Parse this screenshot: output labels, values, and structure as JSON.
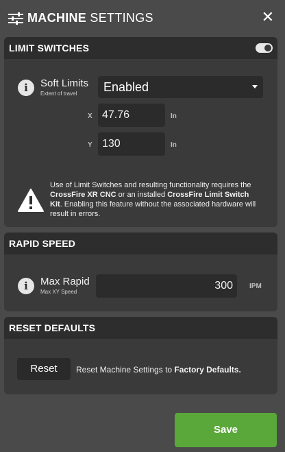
{
  "header": {
    "title_bold": "MACHINE",
    "title_rest": "SETTINGS",
    "close_label": "✕"
  },
  "limit_switches": {
    "title": "LIMIT SWITCHES",
    "toggle_on": true,
    "soft_limits_label": "Soft Limits",
    "soft_limits_sub": "Extent of travel",
    "soft_limits_value": "Enabled",
    "x_label": "X",
    "x_value": "47.76",
    "x_unit": "In",
    "y_label": "Y",
    "y_value": "130",
    "y_unit": "In",
    "warning_1": "Use of Limit Switches and resulting functionality requires the ",
    "warning_b1": "CrossFire XR CNC",
    "warning_2": " or an installed ",
    "warning_b2": "CrossFire Limit Switch Kit",
    "warning_3": ". Enabling this feature without the associated hardware will result in errors."
  },
  "rapid_speed": {
    "title": "RAPID SPEED",
    "max_rapid_label": "Max Rapid",
    "max_rapid_sub": "Max XY Speed",
    "max_rapid_value": "300",
    "unit": "IPM"
  },
  "reset_defaults": {
    "title": "RESET DEFAULTS",
    "button_label": "Reset",
    "text_1": "Reset Machine Settings to ",
    "text_bold": "Factory Defaults."
  },
  "footer": {
    "save_label": "Save"
  },
  "colors": {
    "background": "#4a4a4a",
    "card": "#3a3a3a",
    "card_header": "#2d2d2d",
    "save": "#5aa83a"
  }
}
